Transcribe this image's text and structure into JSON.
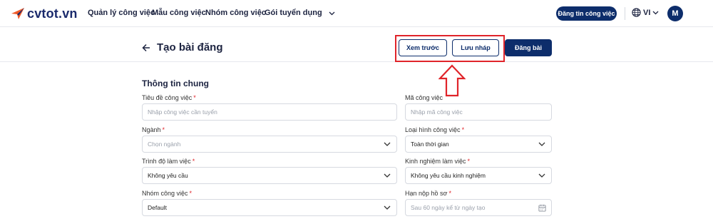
{
  "brand": {
    "logo_text": "cvtot.vn",
    "accent": "#f05a28",
    "primary": "#0d2d6b"
  },
  "nav": {
    "items": [
      "Quản lý công việc",
      "Mẫu công việc",
      "Nhóm công việc",
      "Gói tuyển dụng"
    ],
    "post_job_label": "Đăng tin công việc",
    "language": "VI",
    "avatar_initial": "M"
  },
  "page": {
    "title": "Tạo bài đăng",
    "preview_label": "Xem trước",
    "draft_label": "Lưu nháp",
    "publish_label": "Đăng bài"
  },
  "form": {
    "section_title": "Thông tin chung",
    "job_title": {
      "label": "Tiêu đề công việc",
      "required_mark": "*",
      "placeholder": "Nhập công việc cần tuyển"
    },
    "job_code": {
      "label": "Mã công việc",
      "placeholder": "Nhập mã công việc"
    },
    "industry": {
      "label": "Ngành",
      "required_mark": "*",
      "placeholder": "Chọn ngành"
    },
    "job_type": {
      "label": "Loại hình công việc",
      "required_mark": "*",
      "value": "Toàn thời gian"
    },
    "work_level": {
      "label": "Trình độ làm việc",
      "required_mark": "*",
      "value": "Không yêu cầu"
    },
    "experience": {
      "label": "Kinh nghiệm làm việc",
      "required_mark": "*",
      "value": "Không yêu cầu kinh nghiệm"
    },
    "job_group": {
      "label": "Nhóm công việc",
      "required_mark": "*",
      "value": "Default"
    },
    "deadline": {
      "label": "Hạn nộp hồ sơ",
      "required_mark": "*",
      "placeholder": "Sau 60 ngày kể từ ngày tạo"
    }
  }
}
